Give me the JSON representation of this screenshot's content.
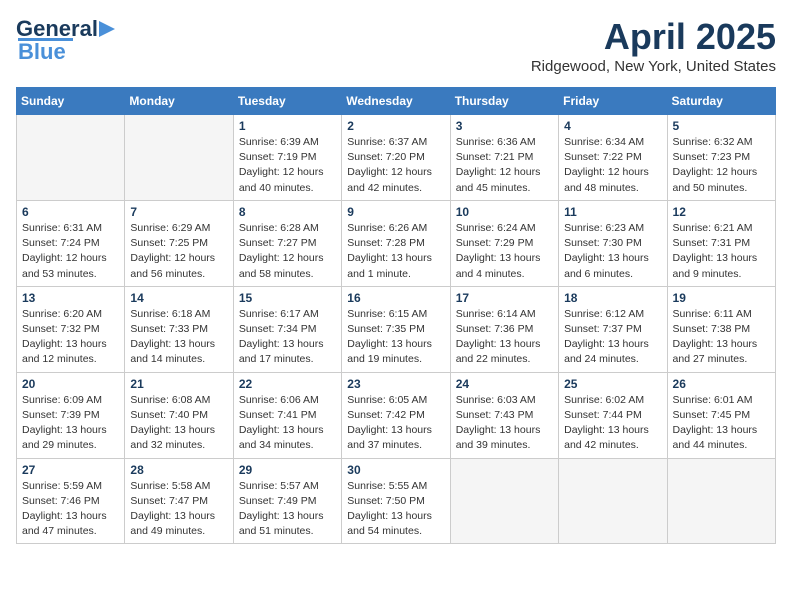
{
  "header": {
    "logo_general": "General",
    "logo_blue": "Blue",
    "month_title": "April 2025",
    "location": "Ridgewood, New York, United States"
  },
  "days_of_week": [
    "Sunday",
    "Monday",
    "Tuesday",
    "Wednesday",
    "Thursday",
    "Friday",
    "Saturday"
  ],
  "weeks": [
    [
      {
        "num": "",
        "info": ""
      },
      {
        "num": "",
        "info": ""
      },
      {
        "num": "1",
        "info": "Sunrise: 6:39 AM\nSunset: 7:19 PM\nDaylight: 12 hours\nand 40 minutes."
      },
      {
        "num": "2",
        "info": "Sunrise: 6:37 AM\nSunset: 7:20 PM\nDaylight: 12 hours\nand 42 minutes."
      },
      {
        "num": "3",
        "info": "Sunrise: 6:36 AM\nSunset: 7:21 PM\nDaylight: 12 hours\nand 45 minutes."
      },
      {
        "num": "4",
        "info": "Sunrise: 6:34 AM\nSunset: 7:22 PM\nDaylight: 12 hours\nand 48 minutes."
      },
      {
        "num": "5",
        "info": "Sunrise: 6:32 AM\nSunset: 7:23 PM\nDaylight: 12 hours\nand 50 minutes."
      }
    ],
    [
      {
        "num": "6",
        "info": "Sunrise: 6:31 AM\nSunset: 7:24 PM\nDaylight: 12 hours\nand 53 minutes."
      },
      {
        "num": "7",
        "info": "Sunrise: 6:29 AM\nSunset: 7:25 PM\nDaylight: 12 hours\nand 56 minutes."
      },
      {
        "num": "8",
        "info": "Sunrise: 6:28 AM\nSunset: 7:27 PM\nDaylight: 12 hours\nand 58 minutes."
      },
      {
        "num": "9",
        "info": "Sunrise: 6:26 AM\nSunset: 7:28 PM\nDaylight: 13 hours\nand 1 minute."
      },
      {
        "num": "10",
        "info": "Sunrise: 6:24 AM\nSunset: 7:29 PM\nDaylight: 13 hours\nand 4 minutes."
      },
      {
        "num": "11",
        "info": "Sunrise: 6:23 AM\nSunset: 7:30 PM\nDaylight: 13 hours\nand 6 minutes."
      },
      {
        "num": "12",
        "info": "Sunrise: 6:21 AM\nSunset: 7:31 PM\nDaylight: 13 hours\nand 9 minutes."
      }
    ],
    [
      {
        "num": "13",
        "info": "Sunrise: 6:20 AM\nSunset: 7:32 PM\nDaylight: 13 hours\nand 12 minutes."
      },
      {
        "num": "14",
        "info": "Sunrise: 6:18 AM\nSunset: 7:33 PM\nDaylight: 13 hours\nand 14 minutes."
      },
      {
        "num": "15",
        "info": "Sunrise: 6:17 AM\nSunset: 7:34 PM\nDaylight: 13 hours\nand 17 minutes."
      },
      {
        "num": "16",
        "info": "Sunrise: 6:15 AM\nSunset: 7:35 PM\nDaylight: 13 hours\nand 19 minutes."
      },
      {
        "num": "17",
        "info": "Sunrise: 6:14 AM\nSunset: 7:36 PM\nDaylight: 13 hours\nand 22 minutes."
      },
      {
        "num": "18",
        "info": "Sunrise: 6:12 AM\nSunset: 7:37 PM\nDaylight: 13 hours\nand 24 minutes."
      },
      {
        "num": "19",
        "info": "Sunrise: 6:11 AM\nSunset: 7:38 PM\nDaylight: 13 hours\nand 27 minutes."
      }
    ],
    [
      {
        "num": "20",
        "info": "Sunrise: 6:09 AM\nSunset: 7:39 PM\nDaylight: 13 hours\nand 29 minutes."
      },
      {
        "num": "21",
        "info": "Sunrise: 6:08 AM\nSunset: 7:40 PM\nDaylight: 13 hours\nand 32 minutes."
      },
      {
        "num": "22",
        "info": "Sunrise: 6:06 AM\nSunset: 7:41 PM\nDaylight: 13 hours\nand 34 minutes."
      },
      {
        "num": "23",
        "info": "Sunrise: 6:05 AM\nSunset: 7:42 PM\nDaylight: 13 hours\nand 37 minutes."
      },
      {
        "num": "24",
        "info": "Sunrise: 6:03 AM\nSunset: 7:43 PM\nDaylight: 13 hours\nand 39 minutes."
      },
      {
        "num": "25",
        "info": "Sunrise: 6:02 AM\nSunset: 7:44 PM\nDaylight: 13 hours\nand 42 minutes."
      },
      {
        "num": "26",
        "info": "Sunrise: 6:01 AM\nSunset: 7:45 PM\nDaylight: 13 hours\nand 44 minutes."
      }
    ],
    [
      {
        "num": "27",
        "info": "Sunrise: 5:59 AM\nSunset: 7:46 PM\nDaylight: 13 hours\nand 47 minutes."
      },
      {
        "num": "28",
        "info": "Sunrise: 5:58 AM\nSunset: 7:47 PM\nDaylight: 13 hours\nand 49 minutes."
      },
      {
        "num": "29",
        "info": "Sunrise: 5:57 AM\nSunset: 7:49 PM\nDaylight: 13 hours\nand 51 minutes."
      },
      {
        "num": "30",
        "info": "Sunrise: 5:55 AM\nSunset: 7:50 PM\nDaylight: 13 hours\nand 54 minutes."
      },
      {
        "num": "",
        "info": ""
      },
      {
        "num": "",
        "info": ""
      },
      {
        "num": "",
        "info": ""
      }
    ]
  ]
}
